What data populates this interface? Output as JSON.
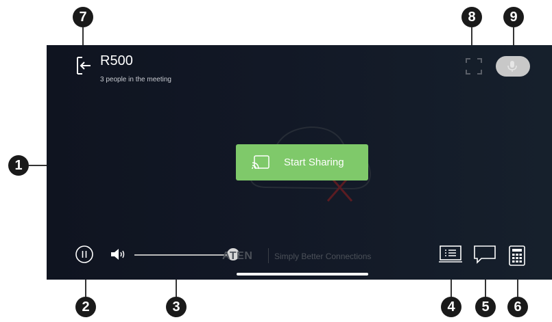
{
  "header": {
    "title": "R500",
    "subtitle": "3 people in the meeting",
    "icons": {
      "exit": "exit-icon",
      "fullscreen": "fullscreen-icon",
      "microphone": "microphone-icon"
    }
  },
  "main": {
    "share_button_label": "Start Sharing",
    "share_icon": "cast-icon"
  },
  "footer": {
    "brand": "ATEN",
    "tagline": "Simply Better Connections",
    "volume_level": 0.95,
    "icons": {
      "pause": "pause-icon",
      "volume": "speaker-icon",
      "presentation": "presentation-icon",
      "chat": "chat-icon",
      "keypad": "keypad-icon"
    }
  },
  "callouts": [
    "1",
    "2",
    "3",
    "4",
    "5",
    "6",
    "7",
    "8",
    "9"
  ],
  "colors": {
    "accent": "#7fc96a",
    "background": "#121826",
    "callout": "#1a1a1a"
  }
}
